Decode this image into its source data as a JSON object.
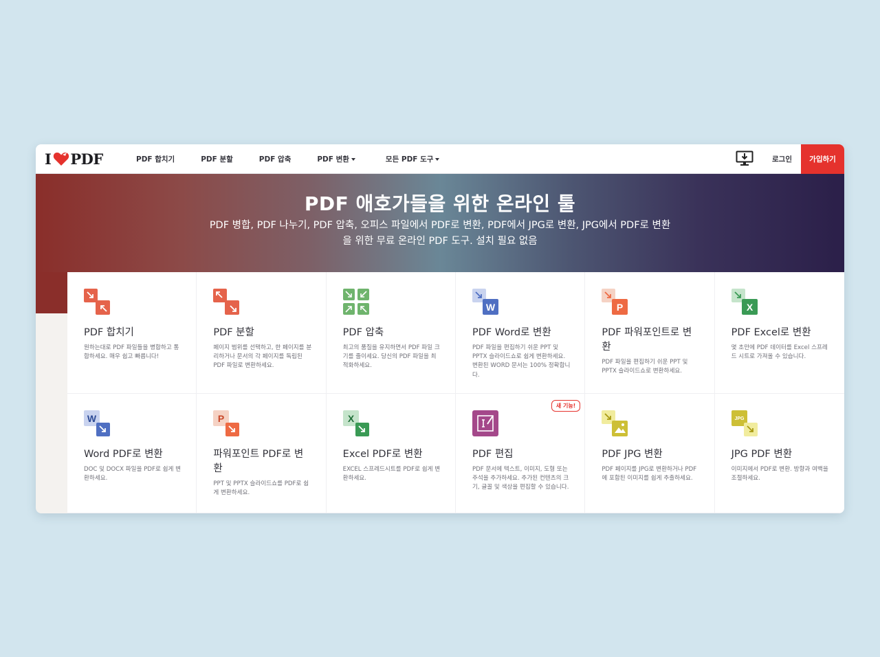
{
  "header": {
    "logo_text_left": "I",
    "logo_text_right": "PDF",
    "nav": [
      {
        "label": "PDF 합치기",
        "dropdown": false
      },
      {
        "label": "PDF 분할",
        "dropdown": false
      },
      {
        "label": "PDF 압축",
        "dropdown": false
      },
      {
        "label": "PDF 변환",
        "dropdown": true
      },
      {
        "label": "모든 PDF 도구",
        "dropdown": true
      }
    ],
    "login_label": "로그인",
    "signup_label": "가입하기"
  },
  "hero": {
    "title": "PDF 애호가들을 위한 온라인 툴",
    "subtitle": "PDF 병합, PDF 나누기, PDF 압축, 오피스 파일에서 PDF로 변환, PDF에서 JPG로 변환, JPG에서 PDF로 변환을 위한 무료 온라인 PDF 도구. 설치 필요 없음"
  },
  "colors": {
    "brand_red": "#e5322d",
    "merge": "#e5634b",
    "compress": "#6fb46d",
    "word": "#4f6fc2",
    "powerpoint": "#ee6a43",
    "excel": "#3a9a55",
    "edit": "#a4488a",
    "jpg": "#cdbf36"
  },
  "tools": [
    {
      "title": "PDF 합치기",
      "desc": "원하는대로 PDF 파일들을 병합하고 통합하세요. 매우 쉽고 빠릅니다!",
      "icon": "merge-icon"
    },
    {
      "title": "PDF 분할",
      "desc": "페이지 범위를 선택하고, 한 페이지를 분리하거나 문서의 각 페이지를 독립된 PDF 파일로 변환하세요.",
      "icon": "split-icon"
    },
    {
      "title": "PDF 압축",
      "desc": "최고의 품질을 유지하면서 PDF 파일 크기를 줄이세요. 당신의 PDF 파일을 최적화하세요.",
      "icon": "compress-icon"
    },
    {
      "title": "PDF Word로 변환",
      "desc": "PDF 파일을 편집하기 쉬운 PPT 및 PPTX 슬라이드쇼로 쉽게 변환하세요. 변환된 WORD 문서는 100% 정확합니다.",
      "icon": "pdf-to-word-icon",
      "letter": "W"
    },
    {
      "title": "PDF 파워포인트로 변환",
      "desc": "PDF 파일을 편집하기 쉬운 PPT 및 PPTX 슬라이드쇼로 변환하세요.",
      "icon": "pdf-to-powerpoint-icon",
      "letter": "P"
    },
    {
      "title": "PDF Excel로 변환",
      "desc": "몇 초만에 PDF 데이터를 Excel 스프레드 시트로 가져올 수 있습니다.",
      "icon": "pdf-to-excel-icon",
      "letter": "X"
    },
    {
      "title": "Word PDF로 변환",
      "desc": "DOC 및 DOCX 파일을 PDF로 쉽게 변환하세요.",
      "icon": "word-to-pdf-icon",
      "letter": "W"
    },
    {
      "title": "파워포인트 PDF로 변환",
      "desc": "PPT 및 PPTX 슬라이드쇼를 PDF로 쉽게 변환하세요.",
      "icon": "powerpoint-to-pdf-icon",
      "letter": "P"
    },
    {
      "title": "Excel PDF로 변환",
      "desc": "EXCEL 스프레드시트를 PDF로 쉽게 변환하세요.",
      "icon": "excel-to-pdf-icon",
      "letter": "X"
    },
    {
      "title": "PDF 편집",
      "desc": "PDF 문서에 텍스트, 이미지, 도형 또는 주석을 추가하세요. 추가된 컨텐츠의 크기, 글꼴 및 색상을 편집할 수 있습니다.",
      "icon": "edit-pdf-icon",
      "badge": "새 기능!"
    },
    {
      "title": "PDF JPG 변환",
      "desc": "PDF 페이지를 JPG로 변환하거나 PDF에 포함된 이미지를 쉽게 추출하세요.",
      "icon": "pdf-to-jpg-icon"
    },
    {
      "title": "JPG PDF 변환",
      "desc": "이미지에서 PDF로 변환. 방향과 여백을 조절하세요.",
      "icon": "jpg-to-pdf-icon",
      "letter": "JPG"
    }
  ]
}
